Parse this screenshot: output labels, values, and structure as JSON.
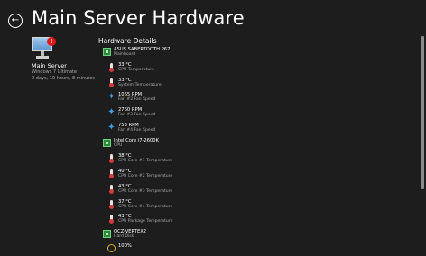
{
  "header": {
    "title": "Main Server Hardware",
    "back_icon": "arrow-left-circle-icon"
  },
  "server": {
    "name": "Main Server",
    "os": "Windows 7 Ultimate",
    "uptime": "0 days, 10 hours, 8 minutes",
    "alert_badge": "!"
  },
  "details": {
    "title": "Hardware Details",
    "items": [
      {
        "kind": "board",
        "value": "ASUS SABERTOOTH P67",
        "label": "Mainboard"
      },
      {
        "kind": "temp",
        "value": "33 °C",
        "label": "CPU Temperature"
      },
      {
        "kind": "temp",
        "value": "33 °C",
        "label": "System Temperature"
      },
      {
        "kind": "fan",
        "value": "1065 RPM",
        "label": "Fan #2 Fan Speed"
      },
      {
        "kind": "fan",
        "value": "2760 RPM",
        "label": "Fan #3 Fan Speed"
      },
      {
        "kind": "fan",
        "value": "753 RPM",
        "label": "Fan #4 Fan Speed"
      },
      {
        "kind": "board",
        "value": "Intel Core i7-2600K",
        "label": "CPU"
      },
      {
        "kind": "temp",
        "value": "38 °C",
        "label": "CPU Core #1 Temperature"
      },
      {
        "kind": "temp",
        "value": "40 °C",
        "label": "CPU Core #2 Temperature"
      },
      {
        "kind": "temp",
        "value": "43 °C",
        "label": "CPU Core #3 Temperature"
      },
      {
        "kind": "temp",
        "value": "37 °C",
        "label": "CPU Core #4 Temperature"
      },
      {
        "kind": "temp",
        "value": "43 °C",
        "label": "CPU Package Temperature"
      },
      {
        "kind": "board",
        "value": "OCZ-VERTEX2",
        "label": "Hard Disk"
      },
      {
        "kind": "load",
        "value": "100%",
        "label": ""
      }
    ]
  },
  "colors": {
    "background": "#1d1d1d",
    "accent_fan": "#3aa0e8",
    "board_green": "#2c8a3d",
    "temp_red": "#d23b3b",
    "alert_red": "#e01a1a"
  }
}
